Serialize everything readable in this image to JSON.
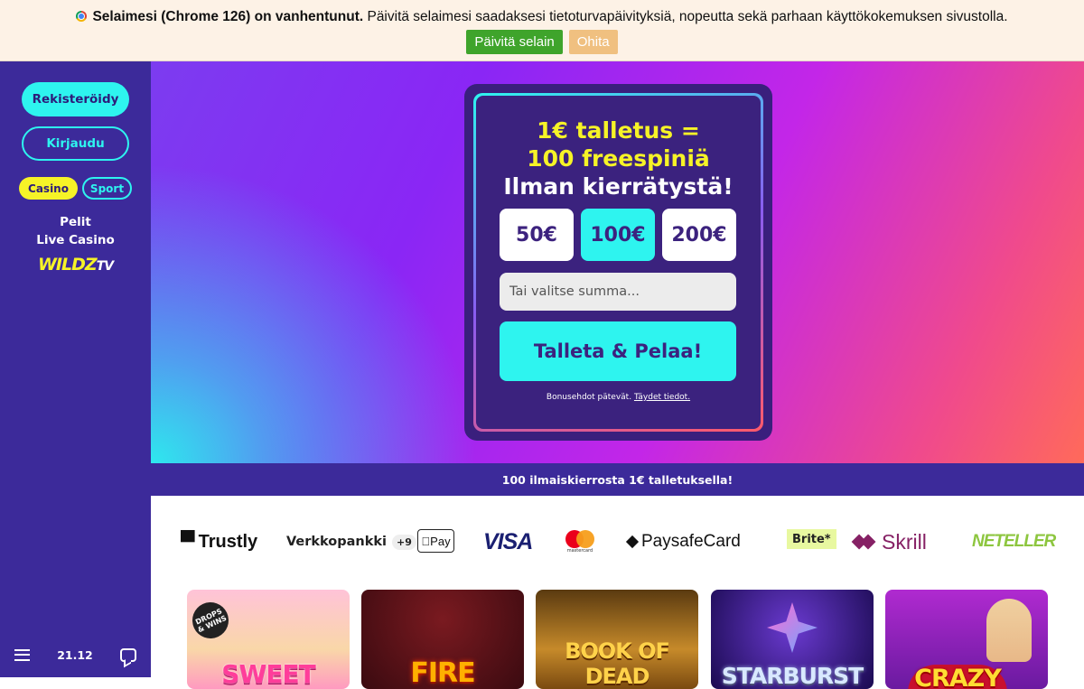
{
  "browser_warning": {
    "bold_text": "Selaimesi (Chrome 126) on vanhentunut.",
    "text": " Päivitä selaimesi saadaksesi tietoturvapäivityksiä, nopeutta sekä parhaan käyttökokemuksen sivustolla.",
    "update_label": "Päivitä selain",
    "skip_label": "Ohita",
    "update_color": "#3fa42b",
    "skip_color": "#f0c080"
  },
  "sidebar": {
    "register_label": "Rekisteröidy",
    "login_label": "Kirjaudu",
    "tabs": [
      {
        "label": "Casino",
        "active": true
      },
      {
        "label": "Sport",
        "active": false
      }
    ],
    "links": [
      "Pelit",
      "Live Casino"
    ],
    "logo_text": "WILDZ",
    "logo_suffix": "TV",
    "time": "21.12",
    "menu_icon": "hamburger-menu-icon",
    "chat_icon": "chat-icon",
    "background_color": "#3c2a9a",
    "accent_color": "#2ef4ef"
  },
  "hero": {
    "offer_line1": "1€ talletus =",
    "offer_line2": "100 freespiniä",
    "offer_line3": "Ilman kierrätystä!",
    "amounts": [
      {
        "label": "50€",
        "selected": false
      },
      {
        "label": "100€",
        "selected": true
      },
      {
        "label": "200€",
        "selected": false
      }
    ],
    "amount_placeholder": "Tai valitse summa...",
    "cta_label": "Talleta & Pelaa!",
    "terms_text": "Bonusehdot pätevät.",
    "terms_link": "Täydet tiedot."
  },
  "strip_text": "100 ilmaiskierrosta 1€ talletuksella!",
  "payments": {
    "trustly": "Trustly",
    "verkkopankki": "Verkkopankki",
    "verkkopankki_more": "+9",
    "apple_pay": "Pay",
    "visa": "VISA",
    "mastercard": "mastercard",
    "paysafecard": "PaysafeCard",
    "brite": "Brite*",
    "skrill": "Skrill",
    "neteller": "NETELLER"
  },
  "games": [
    {
      "title": "SWEET",
      "badge": "DROPS & WINS"
    },
    {
      "title": "FIRE"
    },
    {
      "title": "BOOK OF DEAD"
    },
    {
      "title": "STARBURST"
    },
    {
      "title": "CRAZY"
    }
  ]
}
